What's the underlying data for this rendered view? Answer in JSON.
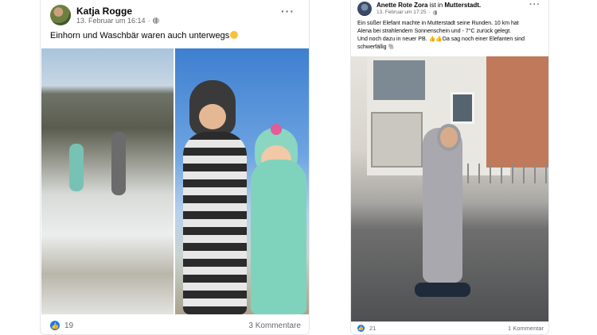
{
  "post_left": {
    "author": "Katja Rogge",
    "date": "13. Februar um 16:14",
    "separator": "·",
    "text": "Einhorn und Waschbär waren auch unterwegs",
    "likes": "19",
    "comments": "3 Kommentare",
    "more_label": "···"
  },
  "post_right": {
    "author": "Anette Rote Zora",
    "is_in": "ist in",
    "place": "Mutterstadt.",
    "date": "13. Februar um 17:25",
    "separator": "·",
    "text_line1": "Ein süßer Elefant machte in Mutterstadt seine Runden. 10 km hat",
    "text_line2": "Alena  bei strahlendem Sonnenschein und - 7°C zurück gelegt.",
    "text_line3": "Und noch dazu in neuer PB. 👍👍Da sag noch einer Elefanten sind",
    "text_line4": "schwerfällig 🐘",
    "likes": "21",
    "comments": "1 Kommentar",
    "more_label": "···"
  },
  "icons": {
    "like": "like-thumb-icon",
    "globe": "globe-icon",
    "more": "more-options-icon"
  },
  "colors": {
    "like_blue": "#1877f2",
    "meta_gray": "#65676b"
  }
}
